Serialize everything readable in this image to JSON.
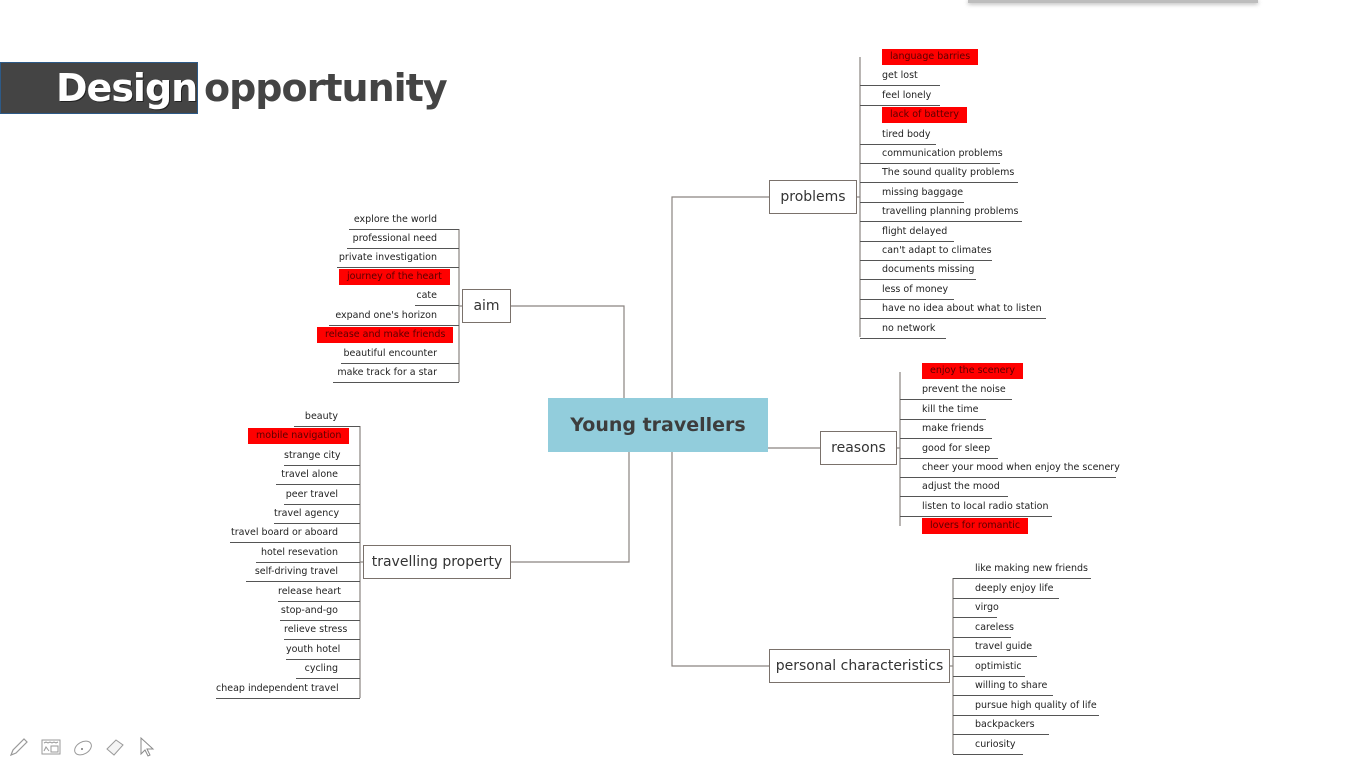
{
  "title": {
    "part1": "Design",
    "part2": "opportunity"
  },
  "colors": {
    "highlight": "#ff0000",
    "center_fill": "#92cddc",
    "title_box": "#444444"
  },
  "mindmap": {
    "center": "Young travellers",
    "branches": {
      "problems": {
        "label": "problems",
        "items": [
          {
            "text": "language barries",
            "highlight": true
          },
          {
            "text": "get lost",
            "highlight": false
          },
          {
            "text": "feel lonely",
            "highlight": false
          },
          {
            "text": "lack of battery",
            "highlight": true
          },
          {
            "text": "tired body",
            "highlight": false
          },
          {
            "text": "communication problems",
            "highlight": false
          },
          {
            "text": "The sound quality problems",
            "highlight": false
          },
          {
            "text": "missing baggage",
            "highlight": false
          },
          {
            "text": "travelling planning problems",
            "highlight": false
          },
          {
            "text": "flight delayed",
            "highlight": false
          },
          {
            "text": "can't adapt to climates",
            "highlight": false
          },
          {
            "text": "documents missing",
            "highlight": false
          },
          {
            "text": "less of money",
            "highlight": false
          },
          {
            "text": "have no idea about what to listen",
            "highlight": false
          },
          {
            "text": "no network",
            "highlight": false
          }
        ]
      },
      "aim": {
        "label": "aim",
        "items": [
          {
            "text": "explore the world",
            "highlight": false
          },
          {
            "text": "professional need",
            "highlight": false
          },
          {
            "text": "private investigation",
            "highlight": false
          },
          {
            "text": "journey of the heart",
            "highlight": true
          },
          {
            "text": "cate",
            "highlight": false
          },
          {
            "text": "expand one's horizon",
            "highlight": false
          },
          {
            "text": "release and make friends",
            "highlight": true
          },
          {
            "text": "beautiful encounter",
            "highlight": false
          },
          {
            "text": "make track for a star",
            "highlight": false
          }
        ]
      },
      "travelling_property": {
        "label": "travelling property",
        "items": [
          {
            "text": "beauty",
            "highlight": false
          },
          {
            "text": "mobile navigation",
            "highlight": true
          },
          {
            "text": "strange city",
            "highlight": false
          },
          {
            "text": "travel alone",
            "highlight": false
          },
          {
            "text": "peer travel",
            "highlight": false
          },
          {
            "text": "travel agency",
            "highlight": false
          },
          {
            "text": "travel board or aboard",
            "highlight": false
          },
          {
            "text": "hotel resevation",
            "highlight": false
          },
          {
            "text": "self-driving travel",
            "highlight": false
          },
          {
            "text": "release heart",
            "highlight": false
          },
          {
            "text": "stop-and-go",
            "highlight": false
          },
          {
            "text": "relieve stress",
            "highlight": false
          },
          {
            "text": "youth hotel",
            "highlight": false
          },
          {
            "text": "cycling",
            "highlight": false
          },
          {
            "text": "cheap independent travel",
            "highlight": false
          }
        ]
      },
      "reasons": {
        "label": "reasons",
        "items": [
          {
            "text": "enjoy the scenery",
            "highlight": true
          },
          {
            "text": "prevent the noise",
            "highlight": false
          },
          {
            "text": "kill the time",
            "highlight": false
          },
          {
            "text": "make friends",
            "highlight": false
          },
          {
            "text": "good for sleep",
            "highlight": false
          },
          {
            "text": "cheer your mood when enjoy the scenery",
            "highlight": false
          },
          {
            "text": "adjust the mood",
            "highlight": false
          },
          {
            "text": "listen to local radio station",
            "highlight": false
          },
          {
            "text": "lovers for romantic",
            "highlight": true
          }
        ]
      },
      "personal_characteristics": {
        "label": "personal characteristics",
        "items": [
          {
            "text": "like making new friends",
            "highlight": false
          },
          {
            "text": "deeply enjoy life",
            "highlight": false
          },
          {
            "text": "virgo",
            "highlight": false
          },
          {
            "text": "careless",
            "highlight": false
          },
          {
            "text": "travel guide",
            "highlight": false
          },
          {
            "text": "optimistic",
            "highlight": false
          },
          {
            "text": "willing to share",
            "highlight": false
          },
          {
            "text": "pursue high quality of life",
            "highlight": false
          },
          {
            "text": "backpackers",
            "highlight": false
          },
          {
            "text": "curiosity",
            "highlight": false
          }
        ]
      }
    }
  },
  "toolbar": {
    "icons": [
      "pen-icon",
      "slide-sorter-icon",
      "spotlight-icon",
      "eraser-icon",
      "pointer-icon"
    ]
  }
}
